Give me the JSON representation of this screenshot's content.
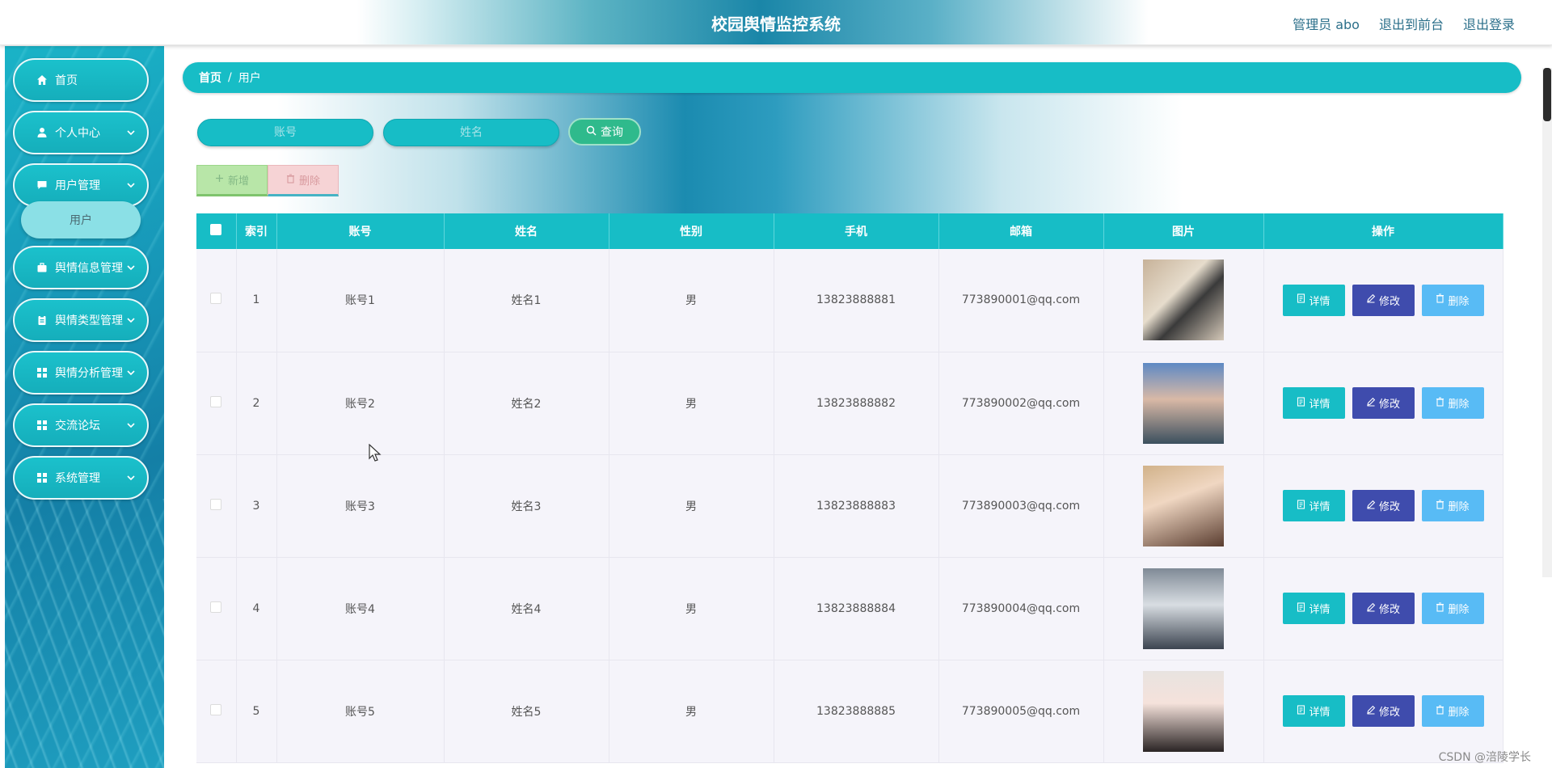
{
  "header": {
    "title": "校园舆情监控系统",
    "admin_label": "管理员 abo",
    "front_link": "退出到前台",
    "logout_link": "退出登录"
  },
  "sidebar": {
    "items": [
      {
        "label": "首页",
        "icon": "home-icon"
      },
      {
        "label": "个人中心",
        "icon": "user-icon"
      },
      {
        "label": "用户管理",
        "icon": "message-icon",
        "submenu": [
          "用户"
        ]
      },
      {
        "label": "舆情信息管理",
        "icon": "suitcase-icon"
      },
      {
        "label": "舆情类型管理",
        "icon": "clipboard-icon"
      },
      {
        "label": "舆情分析管理",
        "icon": "grid-icon"
      },
      {
        "label": "交流论坛",
        "icon": "grid-icon"
      },
      {
        "label": "系统管理",
        "icon": "grid-icon"
      }
    ]
  },
  "breadcrumb": {
    "home": "首页",
    "separator": "/",
    "current": "用户"
  },
  "search": {
    "account_placeholder": "账号",
    "name_placeholder": "姓名",
    "query_label": "查询"
  },
  "toolbar": {
    "add_label": "新增",
    "delete_label": "删除"
  },
  "table": {
    "headers": [
      "索引",
      "账号",
      "姓名",
      "性别",
      "手机",
      "邮箱",
      "图片",
      "操作"
    ],
    "rows": [
      {
        "index": "1",
        "account": "账号1",
        "name": "姓名1",
        "gender": "男",
        "phone": "13823888881",
        "email": "773890001@qq.com"
      },
      {
        "index": "2",
        "account": "账号2",
        "name": "姓名2",
        "gender": "男",
        "phone": "13823888882",
        "email": "773890002@qq.com"
      },
      {
        "index": "3",
        "account": "账号3",
        "name": "姓名3",
        "gender": "男",
        "phone": "13823888883",
        "email": "773890003@qq.com"
      },
      {
        "index": "4",
        "account": "账号4",
        "name": "姓名4",
        "gender": "男",
        "phone": "13823888884",
        "email": "773890004@qq.com"
      },
      {
        "index": "5",
        "account": "账号5",
        "name": "姓名5",
        "gender": "男",
        "phone": "13823888885",
        "email": "773890005@qq.com"
      }
    ],
    "actions": {
      "detail": "详情",
      "edit": "修改",
      "delete": "删除"
    }
  },
  "watermark": "CSDN @涪陵学长",
  "colors": {
    "primary": "#17bdc6",
    "search_button": "#2fba8c",
    "edit_button": "#3f4cad",
    "delete_button": "#58bbf5",
    "row_background": "#f5f4fa"
  }
}
